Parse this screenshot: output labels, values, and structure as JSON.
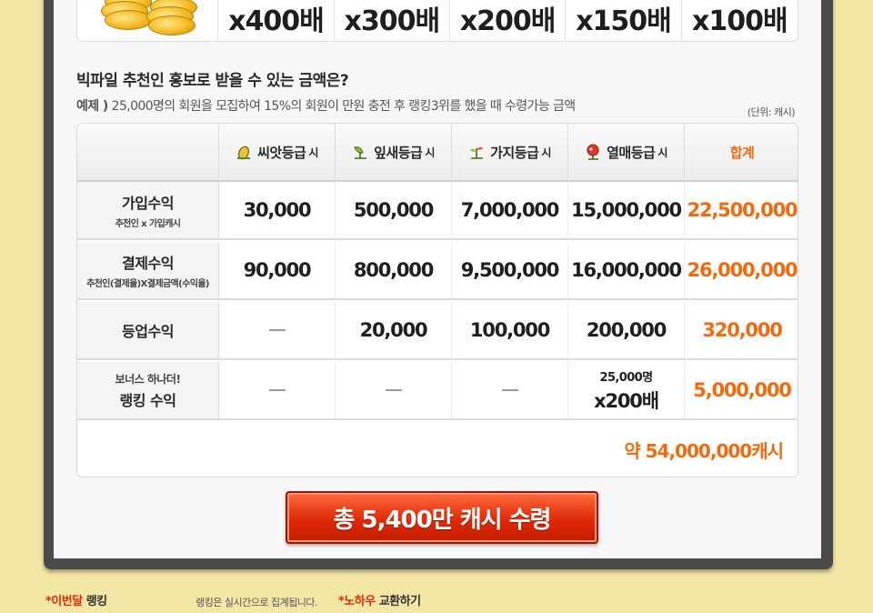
{
  "multipliers": [
    "x400배",
    "x300배",
    "x200배",
    "x150배",
    "x100배"
  ],
  "section_title": "빅파일 추천인 홍보로 받을 수 있는 금액은?",
  "example": {
    "label": "예제 )",
    "text": "25,000명의 회원을 모집하여 15%의 회원이 만원 충전 후 랭킹3위를 했을 때 수령가능 금액"
  },
  "unit_note": "(단위: 캐시)",
  "table": {
    "headers": {
      "stage1": "씨앗등급",
      "stage2": "잎새등급",
      "stage3": "가지등급",
      "stage4": "열매등급",
      "suffix": "시",
      "total": "합계"
    },
    "rows": [
      {
        "label": "가입수익",
        "sub": "추천인 x 가입캐시",
        "values": [
          "30,000",
          "500,000",
          "7,000,000",
          "15,000,000"
        ],
        "total": "22,500,000"
      },
      {
        "label": "결제수익",
        "sub": "추천인(결제율)X결제금액(수익율)",
        "values": [
          "90,000",
          "800,000",
          "9,500,000",
          "16,000,000"
        ],
        "total": "26,000,000"
      },
      {
        "label": "등업수익",
        "values": [
          "",
          "20,000",
          "100,000",
          "200,000"
        ],
        "total": "320,000"
      },
      {
        "pre": "보너스 하나더!",
        "label": "랭킹 수익",
        "rank_top": "25,000명",
        "rank_bottom": "x200배",
        "total": "5,000,000"
      }
    ],
    "grand_total": "약 54,000,000캐시"
  },
  "cta_label": "총 5,400만 캐시 수령",
  "footer": {
    "left_star": "*이번달",
    "left_rest": "랭킹",
    "note": "랭킹은 실시간으로 집계됩니다.",
    "right_star": "*노하우",
    "right_rest": "교환하기"
  },
  "colors": {
    "accent": "#f06a10",
    "cta": "#e02a08",
    "background": "#f3e7a6"
  }
}
